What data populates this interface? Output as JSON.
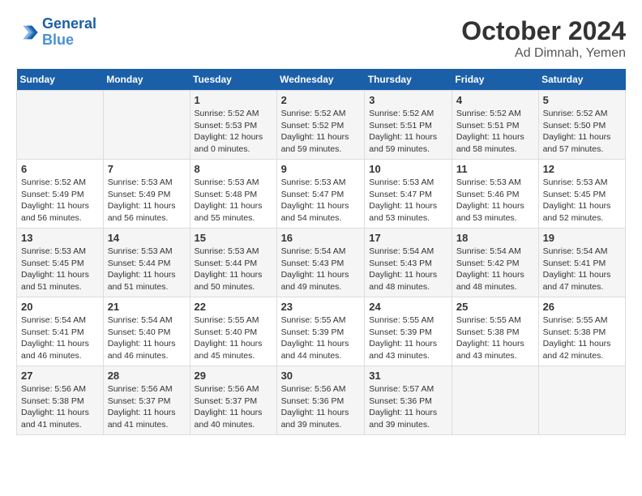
{
  "header": {
    "logo_line1": "General",
    "logo_line2": "Blue",
    "month": "October 2024",
    "location": "Ad Dimnah, Yemen"
  },
  "days_of_week": [
    "Sunday",
    "Monday",
    "Tuesday",
    "Wednesday",
    "Thursday",
    "Friday",
    "Saturday"
  ],
  "weeks": [
    [
      {
        "day": "",
        "info": ""
      },
      {
        "day": "",
        "info": ""
      },
      {
        "day": "1",
        "info": "Sunrise: 5:52 AM\nSunset: 5:53 PM\nDaylight: 12 hours\nand 0 minutes."
      },
      {
        "day": "2",
        "info": "Sunrise: 5:52 AM\nSunset: 5:52 PM\nDaylight: 11 hours\nand 59 minutes."
      },
      {
        "day": "3",
        "info": "Sunrise: 5:52 AM\nSunset: 5:51 PM\nDaylight: 11 hours\nand 59 minutes."
      },
      {
        "day": "4",
        "info": "Sunrise: 5:52 AM\nSunset: 5:51 PM\nDaylight: 11 hours\nand 58 minutes."
      },
      {
        "day": "5",
        "info": "Sunrise: 5:52 AM\nSunset: 5:50 PM\nDaylight: 11 hours\nand 57 minutes."
      }
    ],
    [
      {
        "day": "6",
        "info": "Sunrise: 5:52 AM\nSunset: 5:49 PM\nDaylight: 11 hours\nand 56 minutes."
      },
      {
        "day": "7",
        "info": "Sunrise: 5:53 AM\nSunset: 5:49 PM\nDaylight: 11 hours\nand 56 minutes."
      },
      {
        "day": "8",
        "info": "Sunrise: 5:53 AM\nSunset: 5:48 PM\nDaylight: 11 hours\nand 55 minutes."
      },
      {
        "day": "9",
        "info": "Sunrise: 5:53 AM\nSunset: 5:47 PM\nDaylight: 11 hours\nand 54 minutes."
      },
      {
        "day": "10",
        "info": "Sunrise: 5:53 AM\nSunset: 5:47 PM\nDaylight: 11 hours\nand 53 minutes."
      },
      {
        "day": "11",
        "info": "Sunrise: 5:53 AM\nSunset: 5:46 PM\nDaylight: 11 hours\nand 53 minutes."
      },
      {
        "day": "12",
        "info": "Sunrise: 5:53 AM\nSunset: 5:45 PM\nDaylight: 11 hours\nand 52 minutes."
      }
    ],
    [
      {
        "day": "13",
        "info": "Sunrise: 5:53 AM\nSunset: 5:45 PM\nDaylight: 11 hours\nand 51 minutes."
      },
      {
        "day": "14",
        "info": "Sunrise: 5:53 AM\nSunset: 5:44 PM\nDaylight: 11 hours\nand 51 minutes."
      },
      {
        "day": "15",
        "info": "Sunrise: 5:53 AM\nSunset: 5:44 PM\nDaylight: 11 hours\nand 50 minutes."
      },
      {
        "day": "16",
        "info": "Sunrise: 5:54 AM\nSunset: 5:43 PM\nDaylight: 11 hours\nand 49 minutes."
      },
      {
        "day": "17",
        "info": "Sunrise: 5:54 AM\nSunset: 5:43 PM\nDaylight: 11 hours\nand 48 minutes."
      },
      {
        "day": "18",
        "info": "Sunrise: 5:54 AM\nSunset: 5:42 PM\nDaylight: 11 hours\nand 48 minutes."
      },
      {
        "day": "19",
        "info": "Sunrise: 5:54 AM\nSunset: 5:41 PM\nDaylight: 11 hours\nand 47 minutes."
      }
    ],
    [
      {
        "day": "20",
        "info": "Sunrise: 5:54 AM\nSunset: 5:41 PM\nDaylight: 11 hours\nand 46 minutes."
      },
      {
        "day": "21",
        "info": "Sunrise: 5:54 AM\nSunset: 5:40 PM\nDaylight: 11 hours\nand 46 minutes."
      },
      {
        "day": "22",
        "info": "Sunrise: 5:55 AM\nSunset: 5:40 PM\nDaylight: 11 hours\nand 45 minutes."
      },
      {
        "day": "23",
        "info": "Sunrise: 5:55 AM\nSunset: 5:39 PM\nDaylight: 11 hours\nand 44 minutes."
      },
      {
        "day": "24",
        "info": "Sunrise: 5:55 AM\nSunset: 5:39 PM\nDaylight: 11 hours\nand 43 minutes."
      },
      {
        "day": "25",
        "info": "Sunrise: 5:55 AM\nSunset: 5:38 PM\nDaylight: 11 hours\nand 43 minutes."
      },
      {
        "day": "26",
        "info": "Sunrise: 5:55 AM\nSunset: 5:38 PM\nDaylight: 11 hours\nand 42 minutes."
      }
    ],
    [
      {
        "day": "27",
        "info": "Sunrise: 5:56 AM\nSunset: 5:38 PM\nDaylight: 11 hours\nand 41 minutes."
      },
      {
        "day": "28",
        "info": "Sunrise: 5:56 AM\nSunset: 5:37 PM\nDaylight: 11 hours\nand 41 minutes."
      },
      {
        "day": "29",
        "info": "Sunrise: 5:56 AM\nSunset: 5:37 PM\nDaylight: 11 hours\nand 40 minutes."
      },
      {
        "day": "30",
        "info": "Sunrise: 5:56 AM\nSunset: 5:36 PM\nDaylight: 11 hours\nand 39 minutes."
      },
      {
        "day": "31",
        "info": "Sunrise: 5:57 AM\nSunset: 5:36 PM\nDaylight: 11 hours\nand 39 minutes."
      },
      {
        "day": "",
        "info": ""
      },
      {
        "day": "",
        "info": ""
      }
    ]
  ]
}
